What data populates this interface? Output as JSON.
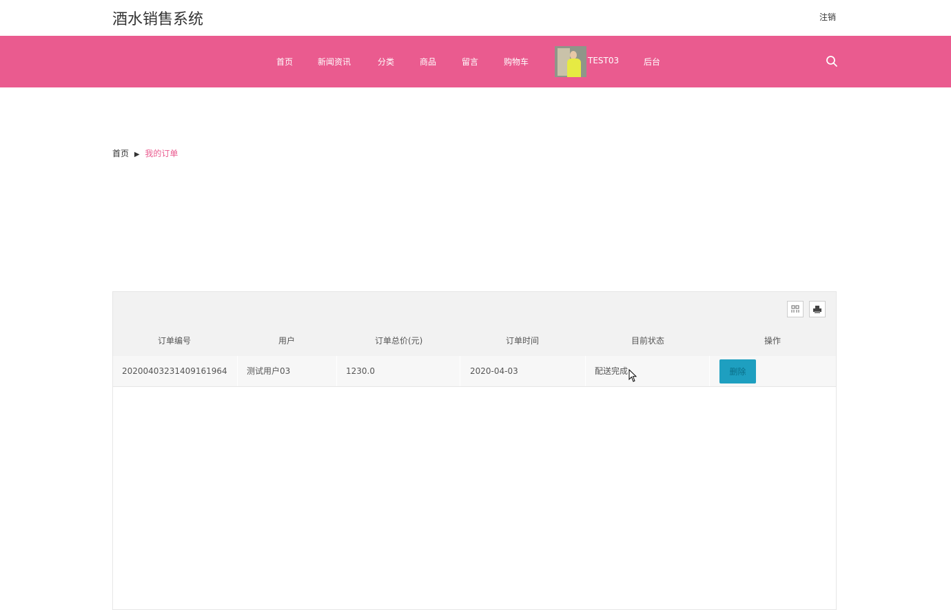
{
  "header": {
    "site_title": "酒水销售系统",
    "logout_label": "注销"
  },
  "nav": {
    "items": [
      "首页",
      "新闻资讯",
      "分类",
      "商品",
      "留言",
      "购物车"
    ],
    "username": "TEST03",
    "admin_label": "后台"
  },
  "breadcrumb": {
    "home": "首页",
    "separator": "▶",
    "current": "我的订单"
  },
  "table": {
    "columns": [
      "订单编号",
      "用户",
      "订单总价(元)",
      "订单时间",
      "目前状态",
      "操作"
    ],
    "rows": [
      {
        "order_no": "20200403231409161964",
        "user": "测试用户03",
        "total": "1230.0",
        "time": "2020-04-03",
        "status": "配送完成",
        "action": "删除"
      }
    ]
  },
  "colors": {
    "nav_bg": "#ea5b8f",
    "accent": "#ea5b8f",
    "action_button": "#1e9fc0"
  }
}
